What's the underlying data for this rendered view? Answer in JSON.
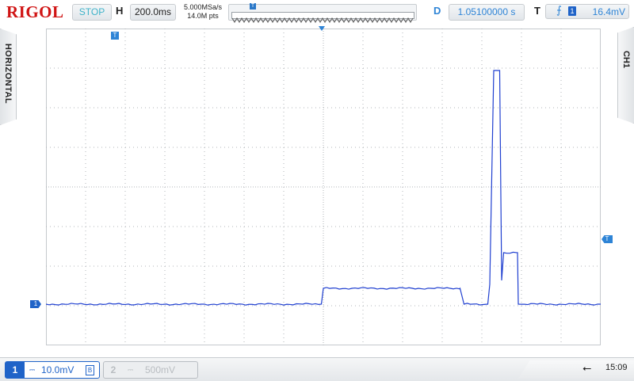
{
  "brand": "RIGOL",
  "status": "STOP",
  "horizontal": {
    "label": "H",
    "timebase": "200.0ms",
    "sample_rate": "5.000MSa/s",
    "memory_depth": "14.0M pts"
  },
  "delay": {
    "label": "D",
    "value": "1.05100000 s"
  },
  "trigger": {
    "label": "T",
    "edge_icon": "rising-edge-icon",
    "source": "1",
    "level": "16.4mV",
    "marker": "T"
  },
  "side_menus": {
    "left": "HORIZONTAL",
    "right": "CH1"
  },
  "channel1": {
    "number": "1",
    "coupling": "⎓",
    "scale": "10.0mV",
    "bw_limit": "B",
    "marker": "1"
  },
  "channel2": {
    "number": "2",
    "coupling": "⎓",
    "scale": "500mV"
  },
  "usb_icon": "usb-icon",
  "usb_symbol": "⭠",
  "clock": "15:09",
  "colors": {
    "trace": "#1f3fd0",
    "accent": "#2e84d6",
    "brand": "#d01414",
    "status": "#3fb3c9"
  },
  "waveform": {
    "grid_divisions": {
      "x": 14,
      "y": 8
    },
    "baseline_div": 0,
    "samples": [
      {
        "t_div": -7.0,
        "v_div": 0
      },
      {
        "t_div": -0.05,
        "v_div": 0
      },
      {
        "t_div": 0.0,
        "v_div": 0.4
      },
      {
        "t_div": 3.45,
        "v_div": 0.4
      },
      {
        "t_div": 3.5,
        "v_div": 0.2
      },
      {
        "t_div": 3.55,
        "v_div": 0
      },
      {
        "t_div": 4.15,
        "v_div": 0
      },
      {
        "t_div": 4.2,
        "v_div": 0.5
      },
      {
        "t_div": 4.3,
        "v_div": 5.9
      },
      {
        "t_div": 4.45,
        "v_div": 5.9
      },
      {
        "t_div": 4.5,
        "v_div": 0.6
      },
      {
        "t_div": 4.55,
        "v_div": 1.3
      },
      {
        "t_div": 4.9,
        "v_div": 1.3
      },
      {
        "t_div": 4.92,
        "v_div": 0
      },
      {
        "t_div": 7.0,
        "v_div": 0
      }
    ]
  }
}
